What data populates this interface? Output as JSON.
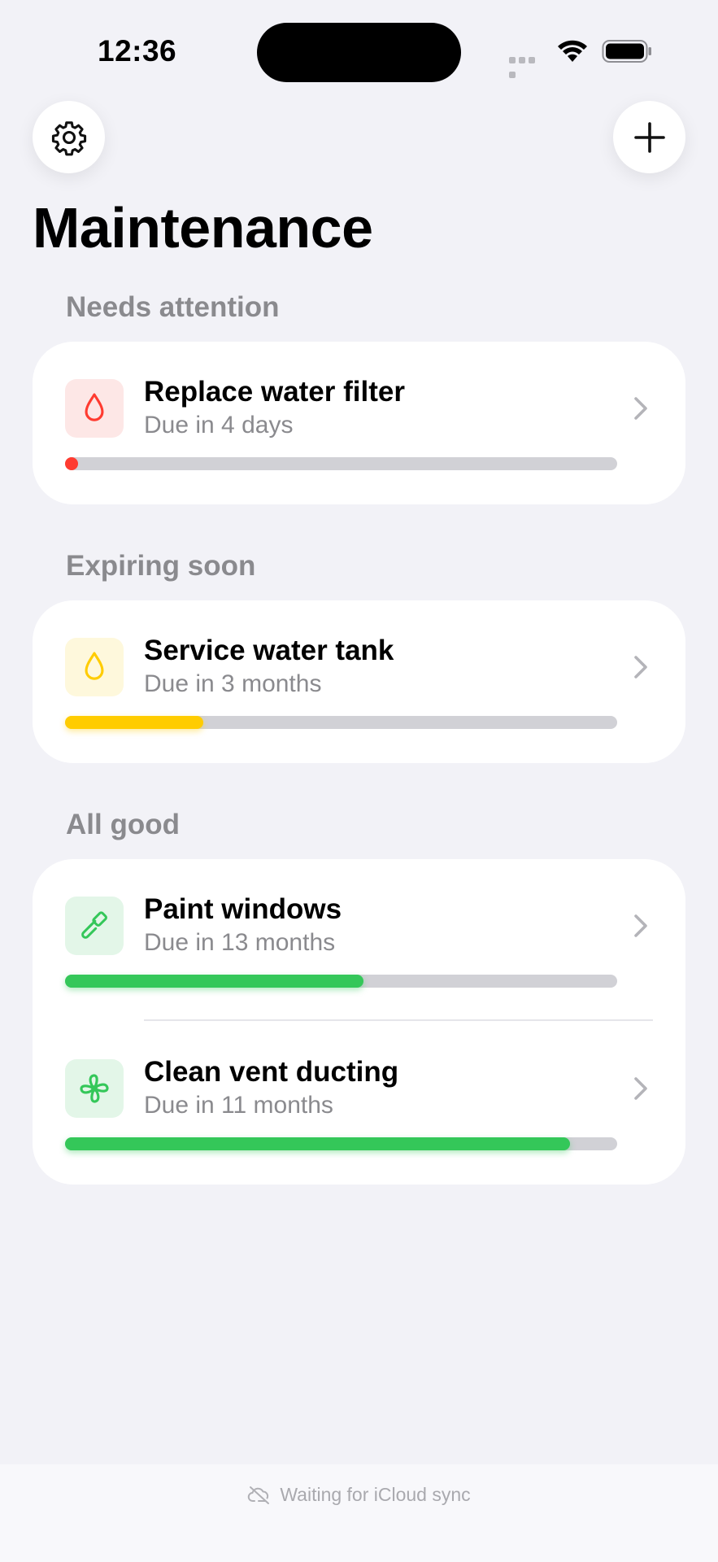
{
  "status_bar": {
    "time": "12:36",
    "icons": [
      "signal-dots-icon",
      "wifi-icon",
      "battery-icon"
    ]
  },
  "toolbar": {
    "settings_icon": "gear-icon",
    "add_icon": "plus-icon"
  },
  "title": "Maintenance",
  "sections": [
    {
      "header": "Needs attention",
      "items": [
        {
          "title": "Replace water filter",
          "subtitle": "Due in 4 days",
          "icon": "drop-icon",
          "color": "#ff3b30",
          "tint": "#fde7e6",
          "progress": 0.02
        }
      ]
    },
    {
      "header": "Expiring soon",
      "items": [
        {
          "title": "Service water tank",
          "subtitle": "Due in 3 months",
          "icon": "drop-icon",
          "color": "#ffcc00",
          "tint": "#fef8dc",
          "progress": 0.25
        }
      ]
    },
    {
      "header": "All good",
      "items": [
        {
          "title": "Paint windows",
          "subtitle": "Due in 13 months",
          "icon": "paintbrush-icon",
          "color": "#34c759",
          "tint": "#e3f6e8",
          "progress": 0.54
        },
        {
          "title": "Clean vent ducting",
          "subtitle": "Due in 11 months",
          "icon": "fan-icon",
          "color": "#34c759",
          "tint": "#e3f6e8",
          "progress": 0.915
        }
      ]
    }
  ],
  "footer": {
    "sync_icon": "cloud-slash-icon",
    "sync_text": "Waiting for iCloud sync"
  }
}
